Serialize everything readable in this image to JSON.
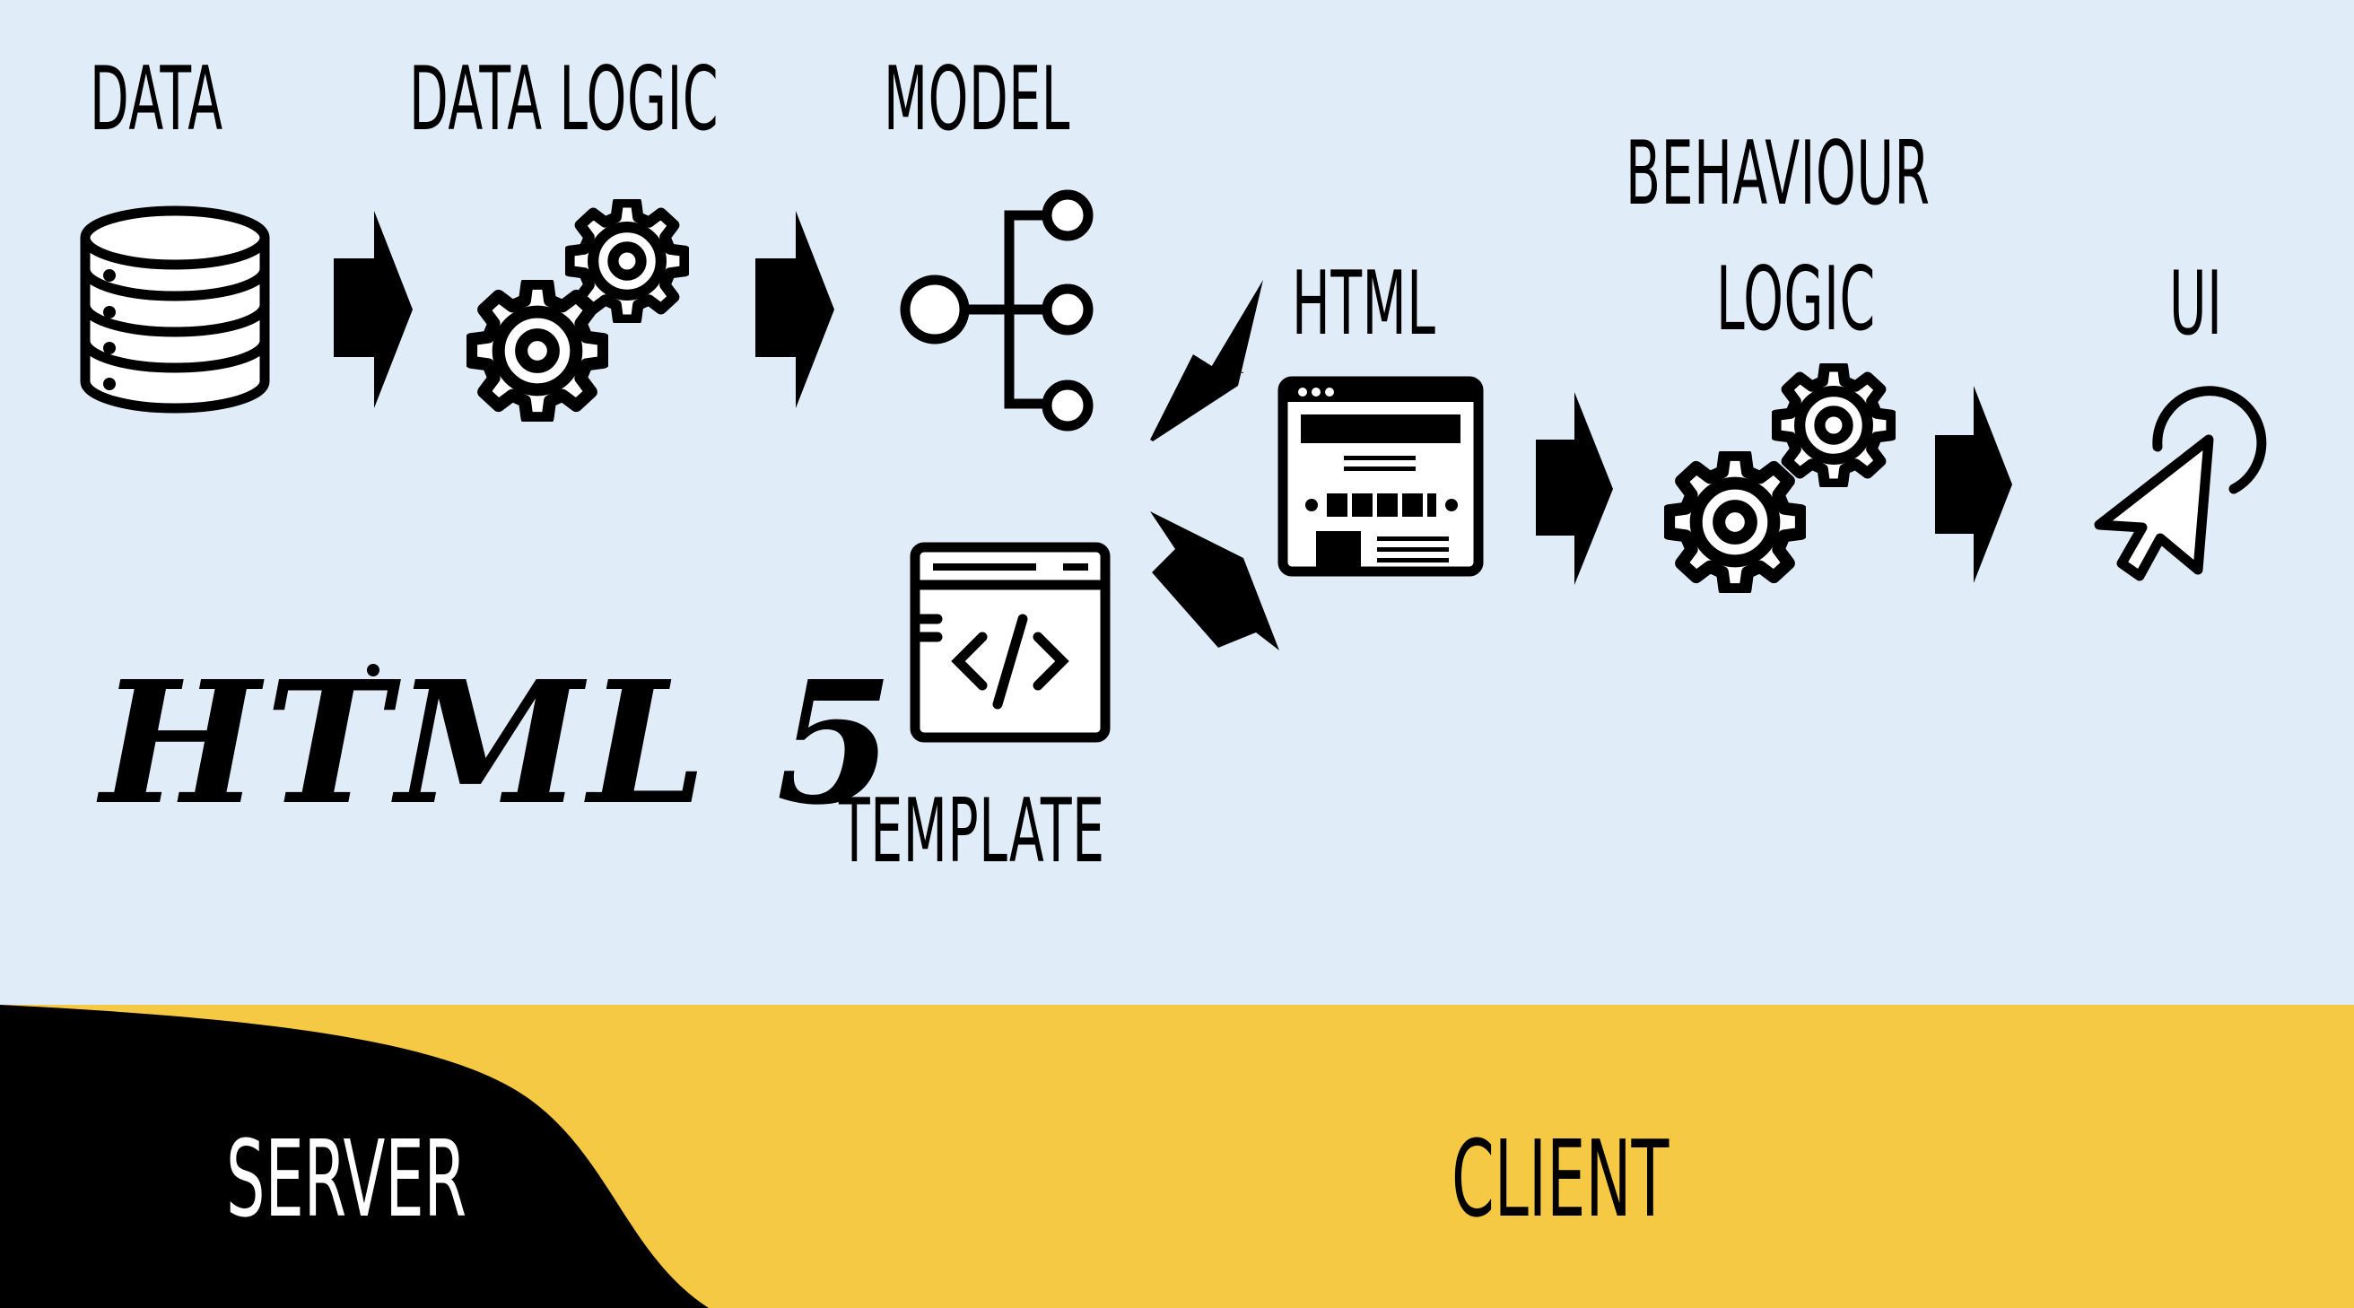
{
  "stages": {
    "data": "DATA",
    "data_logic": "DATA LOGIC",
    "model": "MODEL",
    "template": "TEMPLATE",
    "html": "HTML",
    "behaviour_line1": "BEHAVIOUR",
    "behaviour_line2": "LOGIC",
    "ui": "UI"
  },
  "logo": {
    "text": "HTML 5"
  },
  "zones": {
    "server": "SERVER",
    "client": "CLIENT"
  },
  "icons": {
    "data": "database-icon",
    "data_logic": "gears-icon",
    "model": "hierarchy-tree-icon",
    "template": "code-template-icon",
    "html": "webpage-layout-icon",
    "behaviour_logic": "gears-icon",
    "ui": "cursor-click-icon"
  },
  "colors": {
    "background": "#e0edf9",
    "client": "#f6c945",
    "server": "#000000",
    "ink": "#000000"
  }
}
